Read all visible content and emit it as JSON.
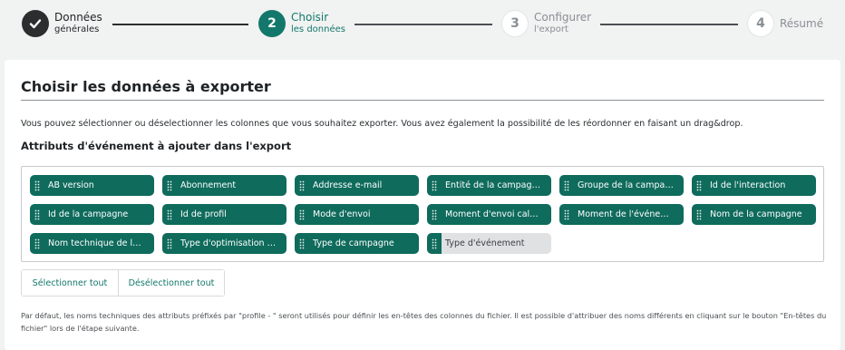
{
  "stepper": {
    "steps": [
      {
        "number": "",
        "title": "Données",
        "sub": "générales",
        "state": "done"
      },
      {
        "number": "2",
        "title": "Choisir",
        "sub": "les données",
        "state": "active"
      },
      {
        "number": "3",
        "title": "Configurer",
        "sub": "l'export",
        "state": "todo"
      },
      {
        "number": "4",
        "title": "Résumé",
        "sub": "",
        "state": "todo"
      }
    ]
  },
  "card": {
    "title": "Choisir les données à exporter",
    "intro": "Vous pouvez sélectionner ou déselectionner les colonnes que vous souhaitez exporter. Vous avez également la possibilité de les réordonner en faisant un drag&drop.",
    "section_title": "Attributs d'événement à ajouter dans l'export"
  },
  "attributes": [
    {
      "label": "AB version",
      "selected": true
    },
    {
      "label": "Abonnement",
      "selected": true
    },
    {
      "label": "Addresse e-mail",
      "selected": true
    },
    {
      "label": "Entité de la campag…",
      "selected": true
    },
    {
      "label": "Groupe de la campa…",
      "selected": true
    },
    {
      "label": "Id de l'interaction",
      "selected": true
    },
    {
      "label": "Id de la campagne",
      "selected": true
    },
    {
      "label": "Id de profil",
      "selected": true
    },
    {
      "label": "Mode d'envoi",
      "selected": true
    },
    {
      "label": "Moment d'envoi cal…",
      "selected": true
    },
    {
      "label": "Moment de l'événe…",
      "selected": true
    },
    {
      "label": "Nom de la campagne",
      "selected": true
    },
    {
      "label": "Nom technique de l…",
      "selected": true
    },
    {
      "label": "Type d'optimisation …",
      "selected": true
    },
    {
      "label": "Type de campagne",
      "selected": true
    },
    {
      "label": "Type d'événement",
      "selected": false
    }
  ],
  "buttons": {
    "select_all": "Sélectionner tout",
    "deselect_all": "Désélectionner tout"
  },
  "footnote": "Par défaut, les noms techniques des attributs préfixés par \"profile - \" seront utilisés pour définir les en-têtes des colonnes du fichier. Il est possible d'attribuer des noms différents en cliquant sur le bouton \"En-têtes du fichier\" lors de l'étape suivante.",
  "colors": {
    "accent": "#13786b",
    "chip": "#0f6b5c",
    "chip_off": "#e0e1e2"
  }
}
